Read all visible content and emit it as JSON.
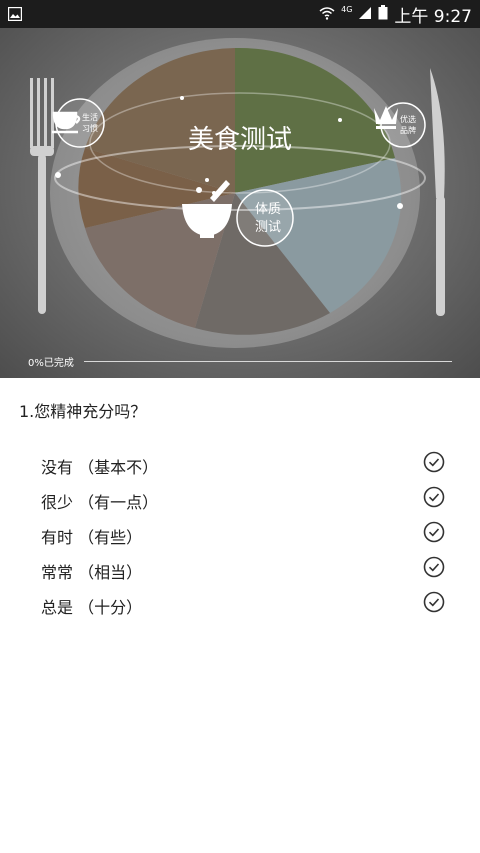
{
  "status_bar": {
    "network": "4G",
    "time": "上午 9:27",
    "icons": [
      "gallery-icon",
      "wifi-icon",
      "signal-icon",
      "battery-icon"
    ]
  },
  "hero": {
    "title": "美食测试",
    "center_badge": [
      "体质",
      "测试"
    ],
    "left_badge": [
      "生活",
      "习惯"
    ],
    "right_badge": [
      "优选",
      "品牌"
    ],
    "icons": [
      "teacup-icon",
      "crown-icon",
      "mortar-bowl-icon",
      "fork-icon",
      "knife-icon"
    ],
    "progress_label": "0%已完成",
    "progress": 0
  },
  "quiz": {
    "question": "1.您精神充分吗？",
    "options": [
      "没有 （基本不）",
      "很少 （有一点）",
      "有时 （有些）",
      "常常 （相当）",
      "总是 （十分）"
    ]
  }
}
